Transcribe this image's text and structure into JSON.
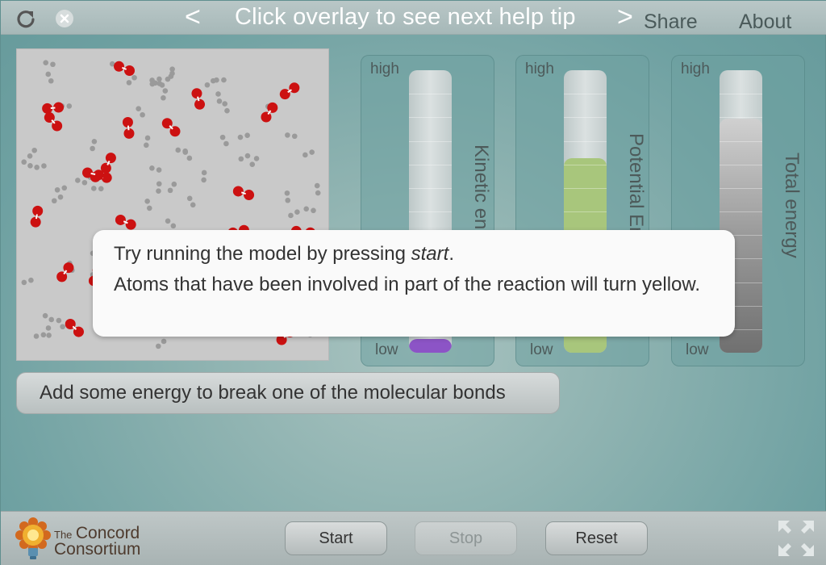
{
  "topbar": {
    "help_title": "Click overlay to see next help tip",
    "prev_symbol": "<",
    "next_symbol": ">",
    "share_label": "Share",
    "about_label": "About",
    "icons": [
      "reload-icon",
      "close-icon"
    ]
  },
  "meters": {
    "kinetic": {
      "label": "Kinetic energy",
      "high": "high",
      "low": "low",
      "level": 0.05,
      "color": "#8c54c6"
    },
    "potential": {
      "label": "Potential Energy",
      "high": "high",
      "low": "low",
      "level": 0.69,
      "color": "#a8c67c"
    },
    "total": {
      "label": "Total energy",
      "high": "high",
      "low": "low",
      "level": 0.83,
      "color": "#9a9a9a"
    }
  },
  "help": {
    "line1_prefix": "Try running the model by pressing ",
    "line1_em": "start",
    "line1_suffix": ".",
    "line2": "Atoms that have been involved in part of the reaction will turn yellow."
  },
  "add_energy_button": "Add some energy to break one of the molecular bonds",
  "controls": {
    "start": "Start",
    "stop": "Stop",
    "reset": "Reset"
  },
  "logo": {
    "the": "The",
    "concord": "Concord",
    "consortium": "Consortium"
  },
  "colors": {
    "oxygen": "#cc1111",
    "hydrogen": "#9a9a9a",
    "background": "#6fa1a2"
  }
}
